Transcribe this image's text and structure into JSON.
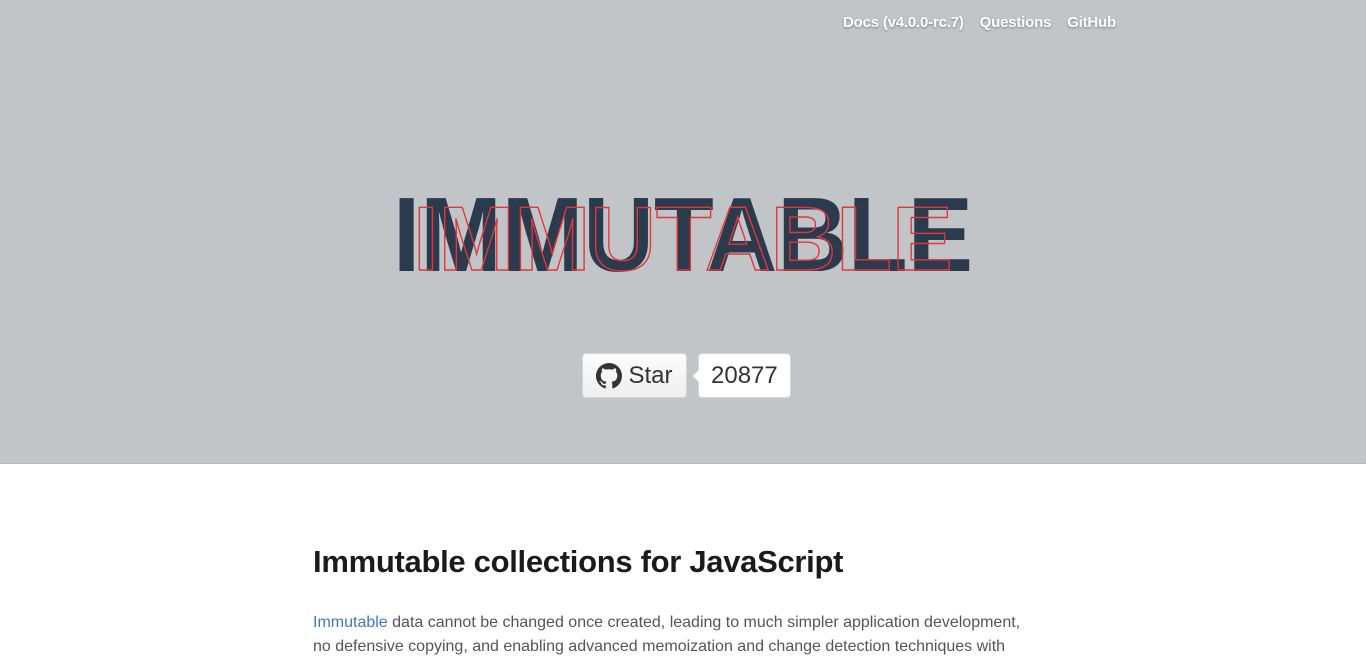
{
  "nav": {
    "docs_label": "Docs (v4.0.0-rc.7)",
    "questions_label": "Questions",
    "github_label": "GitHub"
  },
  "hero": {
    "logo_text": "IMMUTABLE",
    "star_label": "Star",
    "star_count": "20877",
    "colors": {
      "background": "#c1c5c8",
      "logo_fill": "#2b3a4d",
      "logo_outline": "#e2363c"
    }
  },
  "content": {
    "heading": "Immutable collections for JavaScript",
    "intro_link": "Immutable",
    "intro_text_line1": " data cannot be changed once created, leading to much simpler application development,",
    "intro_text_line2": "no defensive copying, and enabling advanced memoization and change detection techniques with"
  }
}
